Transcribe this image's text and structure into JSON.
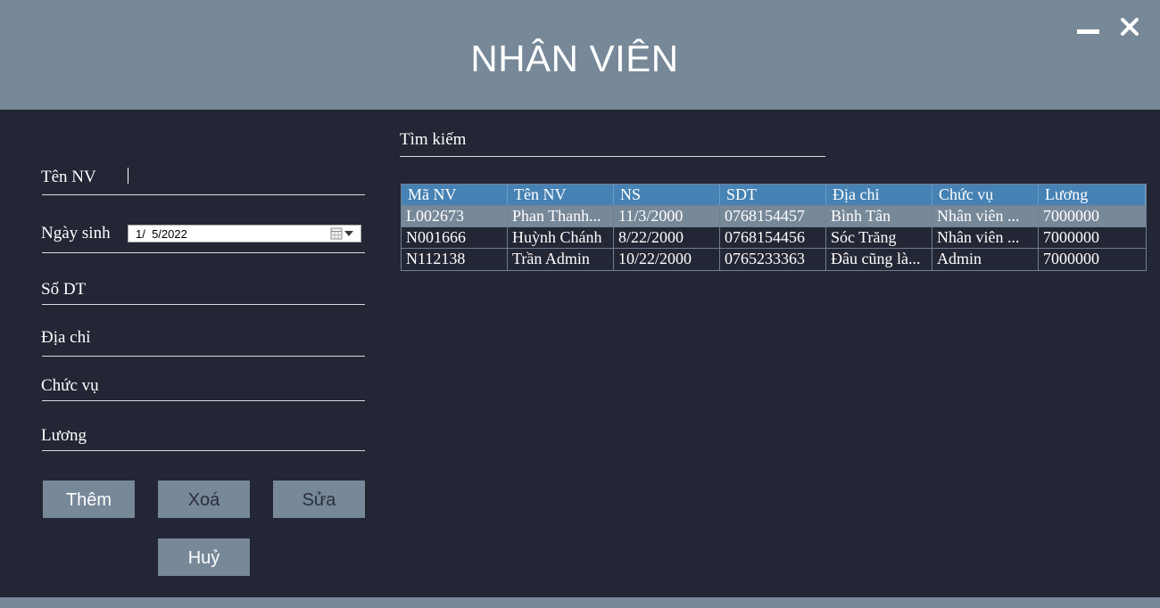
{
  "window": {
    "title": "NHÂN VIÊN",
    "controls": [
      "minimize-icon",
      "close-icon"
    ]
  },
  "form": {
    "fields": {
      "ten_nv": {
        "label": "Tên NV",
        "value": ""
      },
      "ngay_sinh": {
        "label": "Ngày sinh",
        "value": "1/  5/2022"
      },
      "so_dt": {
        "label": "Số DT",
        "value": ""
      },
      "dia_chi": {
        "label": "Địa chỉ",
        "value": ""
      },
      "chuc_vu": {
        "label": "Chức vụ",
        "value": ""
      },
      "luong": {
        "label": "Lương",
        "value": ""
      }
    },
    "buttons": {
      "them": "Thêm",
      "xoa": "Xoá",
      "sua": "Sửa",
      "huy": "Huỷ"
    }
  },
  "search": {
    "label": "Tìm kiếm",
    "value": ""
  },
  "table": {
    "columns": [
      "Mã NV",
      "Tên NV",
      "NS",
      "SDT",
      "Địa chỉ",
      "Chức vụ",
      "Lương"
    ],
    "rows": [
      [
        "L002673",
        "Phan Thanh...",
        "11/3/2000",
        "0768154457",
        "Bình Tân",
        "Nhân viên ...",
        "7000000"
      ],
      [
        "N001666",
        "Huỳnh Chánh",
        "8/22/2000",
        "0768154456",
        "Sóc Trăng",
        "Nhân viên ...",
        "7000000"
      ],
      [
        "N112138",
        "Trần Admin",
        "10/22/2000",
        "0765233363",
        "Đâu cũng là...",
        "Admin",
        "7000000"
      ]
    ],
    "selected_row": 0
  },
  "colors": {
    "background": "#232634",
    "header": "#778899",
    "grid_header": "#4682b4",
    "button": "#778899",
    "button_text_primary": "#ffffff",
    "button_text_secondary": "#2a2f3d"
  }
}
